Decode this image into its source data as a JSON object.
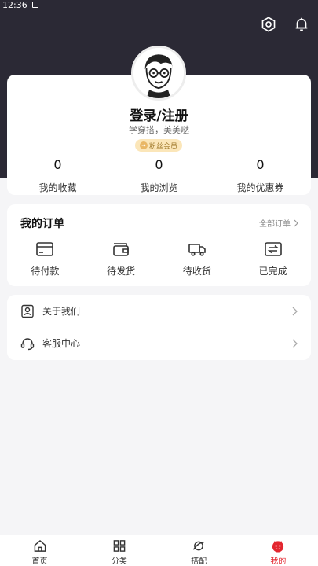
{
  "status_bar": {
    "time": "12:36"
  },
  "profile": {
    "login_label": "登录/注册",
    "tagline": "学穿搭，美美哒",
    "member_badge": "粉丝会员"
  },
  "stats": [
    {
      "value": "0",
      "label": "我的收藏"
    },
    {
      "value": "0",
      "label": "我的浏览"
    },
    {
      "value": "0",
      "label": "我的优惠券"
    }
  ],
  "orders": {
    "title": "我的订单",
    "all_label": "全部订单",
    "items": [
      {
        "label": "待付款",
        "icon": "card-icon"
      },
      {
        "label": "待发货",
        "icon": "wallet-icon"
      },
      {
        "label": "待收货",
        "icon": "truck-icon"
      },
      {
        "label": "已完成",
        "icon": "exchange-icon"
      }
    ]
  },
  "menu": [
    {
      "label": "关于我们",
      "icon": "about-icon"
    },
    {
      "label": "客服中心",
      "icon": "headset-icon"
    }
  ],
  "tabs": [
    {
      "label": "首页",
      "icon": "home-icon"
    },
    {
      "label": "分类",
      "icon": "grid-icon"
    },
    {
      "label": "搭配",
      "icon": "planet-icon"
    },
    {
      "label": "我的",
      "icon": "profile-face-icon",
      "active": true
    }
  ],
  "colors": {
    "header_bg": "#2b2935",
    "accent": "#e3262f",
    "badge_bg": "#fbe6b9"
  }
}
